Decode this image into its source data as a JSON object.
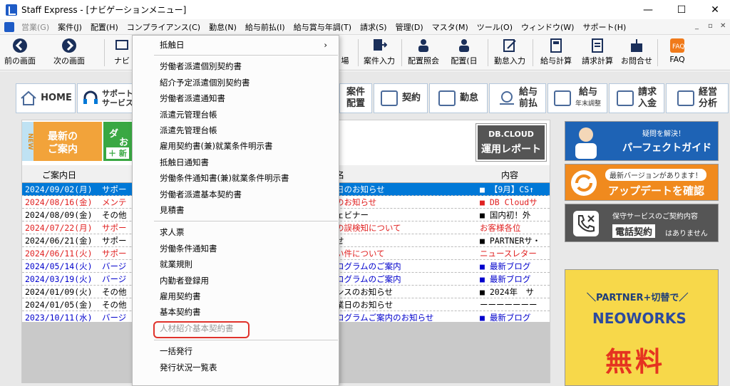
{
  "window": {
    "title": "Staff Express - [ナビゲーションメニュー]",
    "minimize": "—",
    "maximize": "☐",
    "close": "✕"
  },
  "menubar": {
    "items": [
      {
        "label": "営業(G)",
        "disabled": true
      },
      {
        "label": "案件(J)"
      },
      {
        "label": "配置(H)"
      },
      {
        "label": "コンプライアンス(C)"
      },
      {
        "label": "勤怠(N)"
      },
      {
        "label": "給与前払(I)"
      },
      {
        "label": "給与賞与年調(T)"
      },
      {
        "label": "請求(S)"
      },
      {
        "label": "管理(D)"
      },
      {
        "label": "マスタ(M)"
      },
      {
        "label": "ツール(O)"
      },
      {
        "label": "ウィンドウ(W)"
      },
      {
        "label": "サポート(H)"
      }
    ],
    "mdi_min": "_",
    "mdi_restore": "▫",
    "mdi_close": "✕"
  },
  "toolbar": {
    "back": "前の画面",
    "forward": "次の画面",
    "navi": "ナビ",
    "partial": "場",
    "items": [
      "案件入力",
      "配置照会",
      "配置(日",
      "勤怠入力",
      "給与計算",
      "請求計算",
      "お問合せ",
      "FAQ"
    ]
  },
  "navtabs": {
    "home": "HOME",
    "support_l1": "サポート",
    "support_l2": "サービス",
    "anken_l1": "案件",
    "anken_l2": "配置",
    "keiyaku": "契約",
    "kintai": "勤怠",
    "kyuyo_mae_l1": "給与",
    "kyuyo_mae_l2": "前払",
    "kyuyo_l1": "給与",
    "kyuyo_l2": "年末調整",
    "seikyu_l1": "請求",
    "seikyu_l2": "入金",
    "keiei_l1": "経営",
    "keiei_l2": "分析"
  },
  "news_button": {
    "tag": "NEW",
    "line1": "最新の",
    "line2": "ご案内"
  },
  "db_button": {
    "line1": "ダ",
    "line2": "お",
    "plus": "＋ 新"
  },
  "db_report": {
    "line1": "DB.CLOUD",
    "line2": "運用レポート"
  },
  "table": {
    "headers": {
      "date": "ご案内日",
      "title": "名",
      "content": "内容"
    },
    "rows": [
      {
        "date": "2024/09/02(月)",
        "cat": "サポー",
        "title": "日のお知らせ",
        "content": "■ 【9月】CS↑",
        "color": "#0000cc",
        "selected": true
      },
      {
        "date": "2024/08/16(金)",
        "cat": "メンテ",
        "title": "のお知らせ",
        "content": "■ DB Cloudサ",
        "color": "#e02020"
      },
      {
        "date": "2024/08/09(金)",
        "cat": "その他",
        "title": "ェビナー",
        "content": "■ 国内初！外",
        "color": "#000000"
      },
      {
        "date": "2024/07/22(月)",
        "cat": "サポー",
        "title": "の誤検知について",
        "content": "お客様各位",
        "color": "#e02020"
      },
      {
        "date": "2024/06/21(金)",
        "cat": "サポー",
        "title": "せ",
        "content": "■ PARTNERサ・",
        "color": "#000000"
      },
      {
        "date": "2024/06/11(火)",
        "cat": "サポー",
        "title": "い件について",
        "content": "ニュースレター",
        "color": "#e02020"
      },
      {
        "date": "2024/05/14(火)",
        "cat": "バージ",
        "title": "ログラムのご案内",
        "content": "■ 最新ブログ",
        "color": "#0000cc"
      },
      {
        "date": "2024/03/19(火)",
        "cat": "バージ",
        "title": "ログラムのご案内",
        "content": "■ 最新ブログ",
        "color": "#0000cc"
      },
      {
        "date": "2024/01/09(火)",
        "cat": "その他",
        "title": "ンスのお知らせ",
        "content": "■ 2024年　サ",
        "color": "#000000"
      },
      {
        "date": "2024/01/05(金)",
        "cat": "その他",
        "title": "業日のお知らせ",
        "content": "ーーーーーーー",
        "color": "#000000"
      },
      {
        "date": "2023/10/11(水)",
        "cat": "バージ",
        "title": "ログラムご案内のお知らせ",
        "content": "■ 最新ブログ",
        "color": "#0000cc"
      }
    ]
  },
  "banners": {
    "b1": {
      "line1": "疑問を解決！",
      "line2": "パーフェクトガイド"
    },
    "b2": {
      "line1": "最新バージョンがあります！",
      "line2": "アップデートを確認"
    },
    "b3": {
      "line1": "保守サービスのご契約内容",
      "line2": "電話契約",
      "line3": "はありません"
    },
    "b4": {
      "line1": "＼PARTNER+切替で／",
      "line2": "NEOWORKS",
      "line3": "無料"
    }
  },
  "dropdown": {
    "items": [
      {
        "label": "抵触日",
        "submenu": true
      },
      {
        "label": "労働者派遣個別契約書"
      },
      {
        "label": "紹介予定派遣個別契約書"
      },
      {
        "label": "労働者派遣通知書"
      },
      {
        "label": "派遣元管理台帳"
      },
      {
        "label": "派遣先管理台帳"
      },
      {
        "label": "雇用契約書(兼)就業条件明示書"
      },
      {
        "label": "抵触日通知書"
      },
      {
        "label": "労働条件通知書(兼)就業条件明示書"
      },
      {
        "label": "労働者派遣基本契約書"
      },
      {
        "label": "見積書"
      },
      {
        "label": "求人票"
      },
      {
        "label": "労働条件通知書"
      },
      {
        "label": "就業規則"
      },
      {
        "label": "内勤者登録用"
      },
      {
        "label": "雇用契約書"
      },
      {
        "label": "基本契約書"
      },
      {
        "label": "人材紹介基本契約書",
        "disabled": true
      },
      {
        "label": "一括発行"
      },
      {
        "label": "発行状況一覧表"
      }
    ],
    "submenu_arrow": "›"
  },
  "colors": {
    "accent": "#0078d7",
    "highlight": "#e0322b",
    "news": "#f2a33a",
    "green": "#3aa843"
  }
}
